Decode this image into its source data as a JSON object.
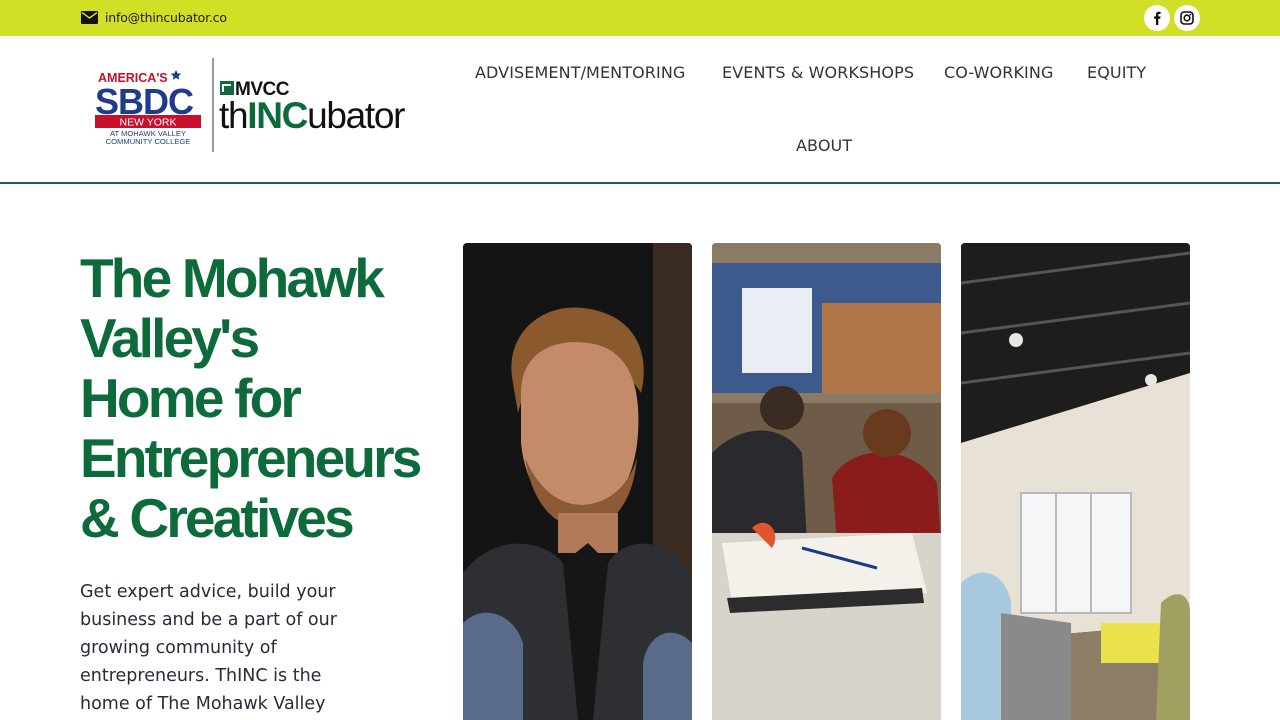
{
  "topbar": {
    "email": "info@thincubator.co",
    "social": [
      {
        "name": "facebook",
        "icon": "facebook-icon"
      },
      {
        "name": "instagram",
        "icon": "instagram-icon"
      }
    ],
    "color": "#d1df27"
  },
  "logo": {
    "sbdc_top": "AMERICA'S",
    "sbdc_main": "SBDC",
    "sbdc_state": "NEW YORK",
    "sbdc_line1": "AT MOHAWK VALLEY",
    "sbdc_line2": "COMMUNITY COLLEGE",
    "mvcc": "MVCC",
    "th": "th",
    "inc": "INC",
    "ubator": "ubator"
  },
  "nav": {
    "items": [
      {
        "label": "ADVISEMENT/MENTORING"
      },
      {
        "label": "EVENTS & WORKSHOPS"
      },
      {
        "label": "CO-WORKING"
      },
      {
        "label": "EQUITY"
      },
      {
        "label": "ABOUT"
      }
    ]
  },
  "hero": {
    "title_lines": [
      "The Mohawk",
      "Valley's",
      "Home for",
      "Entrepreneurs",
      "& Creatives"
    ],
    "text_lines": [
      "Get expert advice, build your",
      "business and be a part of our",
      "growing community of",
      "entrepreneurs. ThINC is the",
      "home of The Mohawk Valley"
    ]
  },
  "colors": {
    "brand_green": "#0d6b3b",
    "accent_lime": "#d1df27"
  }
}
